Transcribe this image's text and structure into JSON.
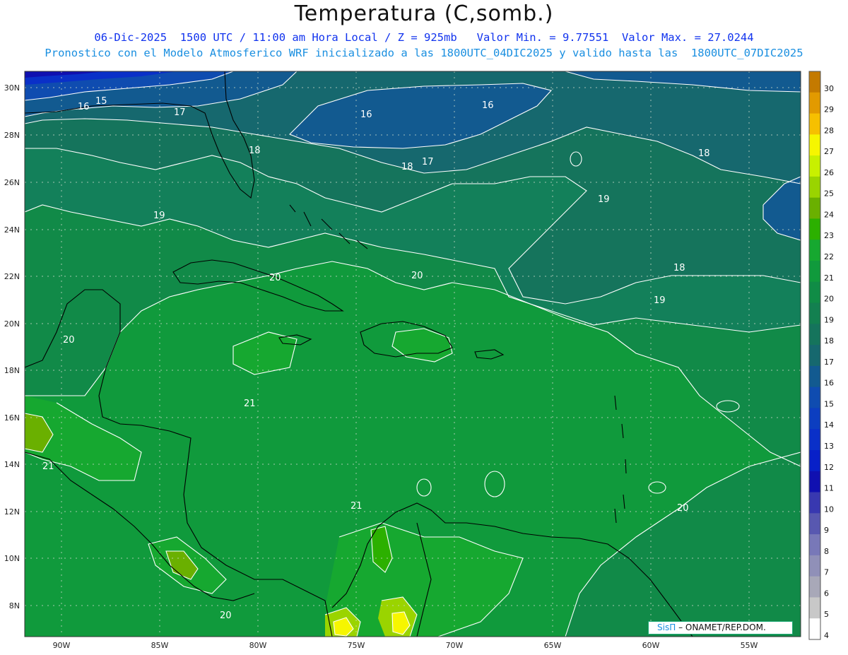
{
  "title": "Temperatura (C,somb.)",
  "subtitle_1": "06-Dic-2025  1500 UTC / 11:00 am Hora Local / Z = 925mb   Valor Min. = 9.77551  Valor Max. = 27.0244",
  "subtitle_2": "Pronostico con el Modelo Atmosferico WRF inicializado a las 1800UTC_04DIC2025 y valido hasta las  1800UTC_07DIC2025",
  "lat_labels": [
    "30N",
    "28N",
    "26N",
    "24N",
    "22N",
    "20N",
    "18N",
    "16N",
    "14N",
    "12N",
    "10N",
    "8N"
  ],
  "lon_labels": [
    "90W",
    "85W",
    "80W",
    "75W",
    "70W",
    "65W",
    "60W",
    "55W"
  ],
  "colorbar_levels": [
    "30",
    "29",
    "28",
    "27",
    "26",
    "25",
    "24",
    "23",
    "22",
    "21",
    "20",
    "19",
    "18",
    "17",
    "16",
    "15",
    "14",
    "13",
    "12",
    "11",
    "10",
    "9",
    "8",
    "7",
    "6",
    "5",
    "4"
  ],
  "colorbar_colors": [
    "#c47a00",
    "#e29a00",
    "#f6c000",
    "#f6f600",
    "#c8f000",
    "#9ad400",
    "#6ab000",
    "#2cb000",
    "#16a830",
    "#109a3c",
    "#108c46",
    "#138050",
    "#15745c",
    "#16686e",
    "#125a90",
    "#0f4cb0",
    "#0c3ec0",
    "#0a30c8",
    "#0820c8",
    "#1010b0",
    "#3838b0",
    "#5858b0",
    "#7878b8",
    "#9090b8",
    "#a8a8b8",
    "#c8c8c8",
    "#ffffff"
  ],
  "contour_labels": [
    "15",
    "16",
    "17",
    "16",
    "16",
    "18",
    "18",
    "17",
    "18",
    "19",
    "19",
    "18",
    "20",
    "20",
    "19",
    "20",
    "21",
    "21",
    "20",
    "21",
    "20"
  ],
  "credit": {
    "brand": "SisΠ",
    "text": "– ONAMET/REP.DOM."
  }
}
